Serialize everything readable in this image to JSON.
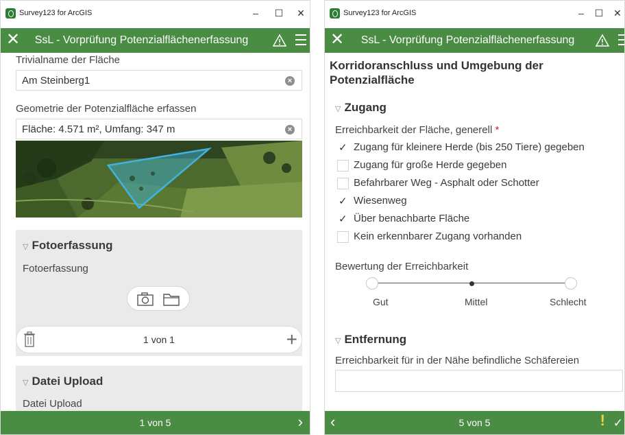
{
  "left_window": {
    "app_name": "Survey123 for ArcGIS",
    "title": "SsL - Vorprüfung Potenzialflächenerfassung",
    "minimize": "–",
    "maximize": "☐",
    "close": "✕",
    "appbar_close": "✕",
    "fields": {
      "trivialname_label": "Trivialname der Fläche",
      "trivialname_value": "Am Steinberg1",
      "geometrie_label": "Geometrie der Potenzialfläche erfassen",
      "geometrie_value": "Fläche: 4.571 m², Umfang: 347 m"
    },
    "foto_group": {
      "header": "Fotoerfassung",
      "label": "Fotoerfassung",
      "pager_text": "1 von 1",
      "plus": "+"
    },
    "upload_group": {
      "header": "Datei Upload",
      "label": "Datei Upload"
    },
    "footer_text": "1 von 5",
    "footer_next": "›"
  },
  "right_window": {
    "app_name": "Survey123 for ArcGIS",
    "title": "SsL - Vorprüfung Potenzialflächenerfassung",
    "minimize": "–",
    "maximize": "☐",
    "close": "✕",
    "appbar_close": "✕",
    "section_title": "Korridoranschluss und Umgebung der Potenzialfläche",
    "zugang_group": {
      "header": "Zugang",
      "question": "Erreichbarkeit der Fläche, generell",
      "required_mark": "*",
      "options": [
        {
          "label": "Zugang für kleinere Herde (bis 250 Tiere) gegeben",
          "checked": true
        },
        {
          "label": "Zugang für große Herde gegeben",
          "checked": false
        },
        {
          "label": "Befahrbarer Weg - Asphalt oder Schotter",
          "checked": false
        },
        {
          "label": "Wiesenweg",
          "checked": true
        },
        {
          "label": "Über benachbarte Fläche",
          "checked": true
        },
        {
          "label": "Kein erkennbarer Zugang vorhanden",
          "checked": false
        }
      ],
      "check_glyph": "✓",
      "rating_label": "Bewertung der Erreichbarkeit",
      "rating_options": [
        "Gut",
        "Mittel",
        "Schlecht"
      ],
      "rating_selected": "Mittel"
    },
    "entfernung_group": {
      "header": "Entfernung",
      "question": "Erreichbarkeit für in der Nähe befindliche Schäfereien",
      "value": ""
    },
    "footer_text": "5 von 5",
    "footer_prev": "‹",
    "footer_submit": "✓"
  },
  "colors": {
    "accent_green": "#4a8c43",
    "group_bg": "#eaeaea",
    "polygon": "#3fb4e0"
  },
  "icons": {
    "clear": "clear-icon",
    "warning": "warning-icon",
    "menu": "menu-icon",
    "camera": "camera-icon",
    "folder": "folder-icon",
    "trash": "trash-icon",
    "collapse": "collapse-triangle-icon"
  }
}
